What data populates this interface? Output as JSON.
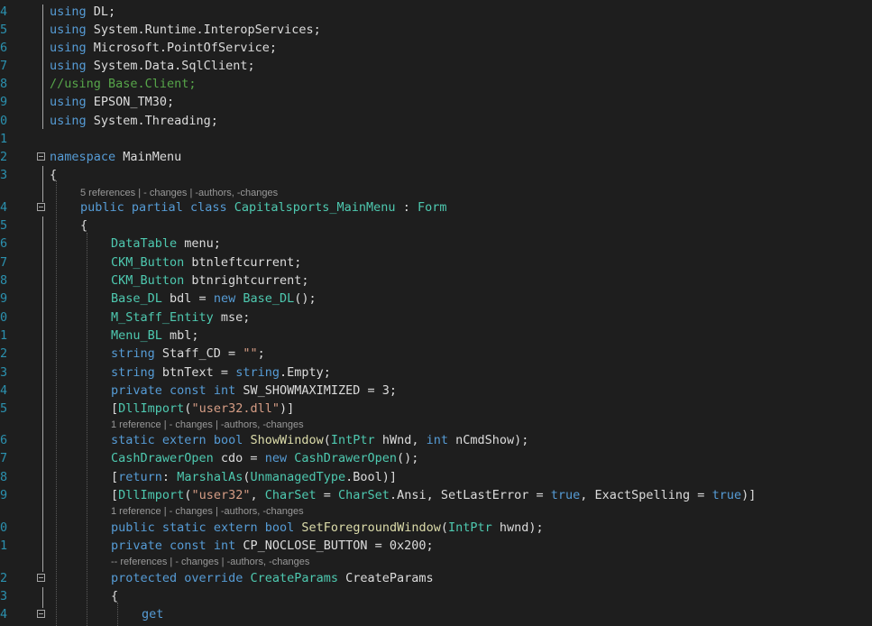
{
  "lines": [
    {
      "n": "4",
      "segs": [
        [
          "kw",
          "using"
        ],
        [
          "pn",
          " DL;"
        ]
      ]
    },
    {
      "n": "5",
      "segs": [
        [
          "kw",
          "using"
        ],
        [
          "pn",
          " System.Runtime.InteropServices;"
        ]
      ]
    },
    {
      "n": "6",
      "segs": [
        [
          "kw",
          "using"
        ],
        [
          "pn",
          " Microsoft.PointOfService;"
        ]
      ]
    },
    {
      "n": "7",
      "segs": [
        [
          "kw",
          "using"
        ],
        [
          "pn",
          " System.Data.SqlClient;"
        ]
      ]
    },
    {
      "n": "8",
      "segs": [
        [
          "cm",
          "//using Base.Client;"
        ]
      ]
    },
    {
      "n": "9",
      "segs": [
        [
          "kw",
          "using"
        ],
        [
          "pn",
          " EPSON_TM30;"
        ]
      ]
    },
    {
      "n": "0",
      "segs": [
        [
          "kw",
          "using"
        ],
        [
          "pn",
          " System.Threading;"
        ]
      ]
    },
    {
      "n": "1",
      "segs": []
    },
    {
      "n": "2",
      "segs": [
        [
          "kw",
          "namespace"
        ],
        [
          "pn",
          " MainMenu"
        ]
      ]
    },
    {
      "n": "3",
      "segs": [
        [
          "pn",
          "{"
        ]
      ]
    },
    {
      "n": "4",
      "segs": [
        [
          "kw",
          "public"
        ],
        [
          "pn",
          " "
        ],
        [
          "kw",
          "partial"
        ],
        [
          "pn",
          " "
        ],
        [
          "kw",
          "class"
        ],
        [
          "pn",
          " "
        ],
        [
          "ty",
          "Capitalsports_MainMenu"
        ],
        [
          "pn",
          " : "
        ],
        [
          "ty",
          "Form"
        ]
      ]
    },
    {
      "n": "5",
      "segs": [
        [
          "pn",
          "{"
        ]
      ]
    },
    {
      "n": "6",
      "segs": [
        [
          "ty",
          "DataTable"
        ],
        [
          "pn",
          " menu;"
        ]
      ]
    },
    {
      "n": "7",
      "segs": [
        [
          "ty",
          "CKM_Button"
        ],
        [
          "pn",
          " btnleftcurrent;"
        ]
      ]
    },
    {
      "n": "8",
      "segs": [
        [
          "ty",
          "CKM_Button"
        ],
        [
          "pn",
          " btnrightcurrent;"
        ]
      ]
    },
    {
      "n": "9",
      "segs": [
        [
          "ty",
          "Base_DL"
        ],
        [
          "pn",
          " bdl = "
        ],
        [
          "kw",
          "new"
        ],
        [
          "pn",
          " "
        ],
        [
          "ty",
          "Base_DL"
        ],
        [
          "pn",
          "();"
        ]
      ]
    },
    {
      "n": "0",
      "segs": [
        [
          "ty",
          "M_Staff_Entity"
        ],
        [
          "pn",
          " mse;"
        ]
      ]
    },
    {
      "n": "1",
      "segs": [
        [
          "ty",
          "Menu_BL"
        ],
        [
          "pn",
          " mbl;"
        ]
      ]
    },
    {
      "n": "2",
      "segs": [
        [
          "kw",
          "string"
        ],
        [
          "pn",
          " Staff_CD = "
        ],
        [
          "st",
          "\"\""
        ],
        [
          "pn",
          ";"
        ]
      ]
    },
    {
      "n": "3",
      "segs": [
        [
          "kw",
          "string"
        ],
        [
          "pn",
          " btnText = "
        ],
        [
          "kw",
          "string"
        ],
        [
          "pn",
          ".Empty;"
        ]
      ]
    },
    {
      "n": "4",
      "segs": [
        [
          "kw",
          "private"
        ],
        [
          "pn",
          " "
        ],
        [
          "kw",
          "const"
        ],
        [
          "pn",
          " "
        ],
        [
          "kw",
          "int"
        ],
        [
          "pn",
          " SW_SHOWMAXIMIZED = 3;"
        ]
      ]
    },
    {
      "n": "5",
      "segs": [
        [
          "pn",
          "["
        ],
        [
          "ty",
          "DllImport"
        ],
        [
          "pn",
          "("
        ],
        [
          "st",
          "\"user32.dll\""
        ],
        [
          "pn",
          ")]"
        ]
      ]
    },
    {
      "n": "6",
      "segs": [
        [
          "kw",
          "static"
        ],
        [
          "pn",
          " "
        ],
        [
          "kw",
          "extern"
        ],
        [
          "pn",
          " "
        ],
        [
          "kw",
          "bool"
        ],
        [
          "pn",
          " "
        ],
        [
          "fn",
          "ShowWindow"
        ],
        [
          "pn",
          "("
        ],
        [
          "ty",
          "IntPtr"
        ],
        [
          "pn",
          " hWnd, "
        ],
        [
          "kw",
          "int"
        ],
        [
          "pn",
          " nCmdShow);"
        ]
      ]
    },
    {
      "n": "7",
      "segs": [
        [
          "ty",
          "CashDrawerOpen"
        ],
        [
          "pn",
          " cdo = "
        ],
        [
          "kw",
          "new"
        ],
        [
          "pn",
          " "
        ],
        [
          "ty",
          "CashDrawerOpen"
        ],
        [
          "pn",
          "();"
        ]
      ]
    },
    {
      "n": "8",
      "segs": [
        [
          "pn",
          "["
        ],
        [
          "kw",
          "return"
        ],
        [
          "pn",
          ": "
        ],
        [
          "ty",
          "MarshalAs"
        ],
        [
          "pn",
          "("
        ],
        [
          "ty",
          "UnmanagedType"
        ],
        [
          "pn",
          ".Bool)]"
        ]
      ]
    },
    {
      "n": "9",
      "segs": [
        [
          "pn",
          "["
        ],
        [
          "ty",
          "DllImport"
        ],
        [
          "pn",
          "("
        ],
        [
          "st",
          "\"user32\""
        ],
        [
          "pn",
          ", "
        ],
        [
          "ty",
          "CharSet"
        ],
        [
          "pn",
          " = "
        ],
        [
          "ty",
          "CharSet"
        ],
        [
          "pn",
          ".Ansi, SetLastError = "
        ],
        [
          "kw",
          "true"
        ],
        [
          "pn",
          ", ExactSpelling = "
        ],
        [
          "kw",
          "true"
        ],
        [
          "pn",
          ")]"
        ]
      ]
    },
    {
      "n": "0",
      "segs": [
        [
          "kw",
          "public"
        ],
        [
          "pn",
          " "
        ],
        [
          "kw",
          "static"
        ],
        [
          "pn",
          " "
        ],
        [
          "kw",
          "extern"
        ],
        [
          "pn",
          " "
        ],
        [
          "kw",
          "bool"
        ],
        [
          "pn",
          " "
        ],
        [
          "fn",
          "SetForegroundWindow"
        ],
        [
          "pn",
          "("
        ],
        [
          "ty",
          "IntPtr"
        ],
        [
          "pn",
          " hwnd);"
        ]
      ]
    },
    {
      "n": "1",
      "segs": [
        [
          "kw",
          "private"
        ],
        [
          "pn",
          " "
        ],
        [
          "kw",
          "const"
        ],
        [
          "pn",
          " "
        ],
        [
          "kw",
          "int"
        ],
        [
          "pn",
          " CP_NOCLOSE_BUTTON = 0x200;"
        ]
      ]
    },
    {
      "n": "2",
      "segs": [
        [
          "kw",
          "protected"
        ],
        [
          "pn",
          " "
        ],
        [
          "kw",
          "override"
        ],
        [
          "pn",
          " "
        ],
        [
          "ty",
          "CreateParams"
        ],
        [
          "pn",
          " CreateParams"
        ]
      ]
    },
    {
      "n": "3",
      "segs": [
        [
          "pn",
          "{"
        ]
      ]
    },
    {
      "n": "4",
      "segs": [
        [
          "kw",
          "get"
        ]
      ]
    }
  ],
  "codelens": [
    "5 references | - changes | -authors, -changes",
    "1 reference | - changes | -authors, -changes",
    "1 reference | - changes | -authors, -changes",
    "-- references | - changes | -authors, -changes"
  ]
}
